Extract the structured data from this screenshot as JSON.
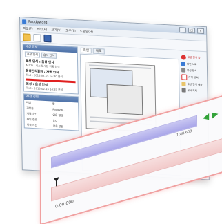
{
  "window": {
    "title": "Paddyword",
    "controls": {
      "minimize": "–",
      "maximize": "□",
      "close": "×"
    }
  },
  "menu": [
    "파일(F)",
    "편집(E)",
    "보기(V)",
    "도구(T)",
    "도움말(H)"
  ],
  "toolbar": [
    "open-folder-icon",
    "new-page-icon",
    "save-icon"
  ],
  "left_panel": {
    "header": "세션 정보",
    "tabs": [
      "음성 인식",
      "음식 인식"
    ],
    "items": [
      {
        "title": "음성 인식 : 음성 인식",
        "sub": "AUTO : 시스템 사용 자동 인식"
      },
      {
        "title": "음성인식결과 : 자동 인식",
        "sub": "Text : 2013.02.15 14:30 분석"
      },
      {
        "title": "음성 : 음성 인식",
        "sub": "Text : 2013.02.15 14:33 분석"
      }
    ]
  },
  "lower_panel": {
    "header": "세션 정보",
    "rows": [
      [
        "대상",
        "말"
      ],
      [
        "가청음",
        "Paddyw..."
      ],
      [
        "기록시간",
        "없음 없음"
      ],
      [
        "파일 경로",
        "1:0"
      ],
      [
        "지속 시간",
        "없음 없음"
      ]
    ]
  },
  "center": {
    "tabs": [
      "화면",
      "메모"
    ]
  },
  "right_panel": {
    "status": "음성 인식 중",
    "items": [
      {
        "icon": "record-icon",
        "label": "화면 녹화"
      },
      {
        "icon": "mic-icon",
        "label": "음성 인식"
      },
      {
        "icon": "rect-icon",
        "label": "자막 영역"
      },
      {
        "icon": "doc-icon",
        "label": "음성 인식 내용"
      },
      {
        "icon": "tag-icon",
        "label": "문서 목록"
      }
    ]
  },
  "timeline": {
    "end_time": "1:48.600",
    "start_time": "0:00.000",
    "nav": [
      "◀",
      "▶"
    ]
  }
}
